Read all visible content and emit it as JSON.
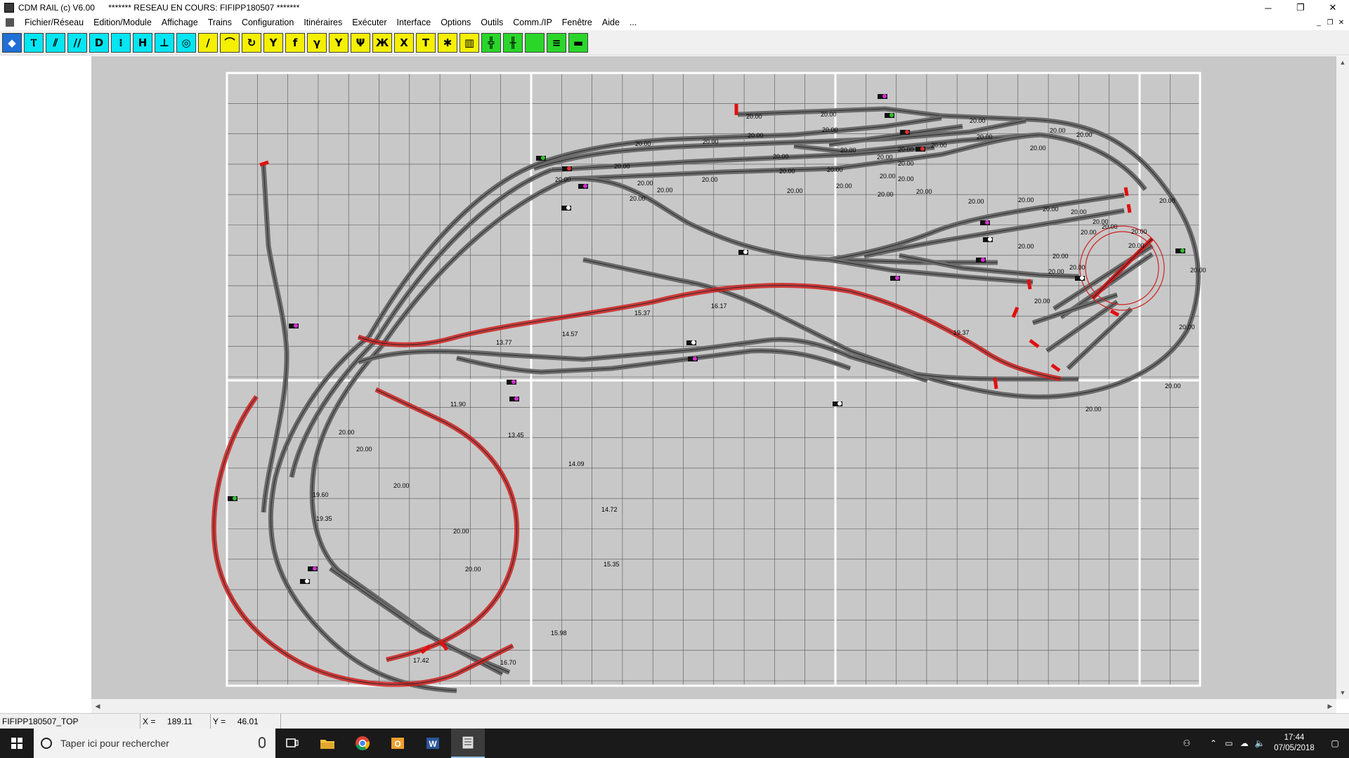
{
  "window": {
    "app_title": "CDM RAIL (c) V6.00",
    "network_title": "******* RESEAU EN COURS: FIFIPP180507 *******",
    "minimize": "─",
    "restore": "❐",
    "close": "✕"
  },
  "menu": {
    "items": [
      "Fichier/Réseau",
      "Edition/Module",
      "Affichage",
      "Trains",
      "Configuration",
      "Itinéraires",
      "Exécuter",
      "Interface",
      "Options",
      "Outils",
      "Comm./IP",
      "Fenêtre",
      "Aide",
      "..."
    ],
    "mdi_minimize": "_",
    "mdi_restore": "❐",
    "mdi_close": "✕"
  },
  "toolbar": {
    "buttons": [
      {
        "name": "zoom-tool",
        "glyph": "◆",
        "color": "blue"
      },
      {
        "name": "signal-tool",
        "glyph": "Ⲧ",
        "color": "cyan"
      },
      {
        "name": "decoupler-tool",
        "glyph": "⫽",
        "color": "cyan"
      },
      {
        "name": "double-track-tool",
        "glyph": "//",
        "color": "cyan"
      },
      {
        "name": "curve-detect-tool",
        "glyph": "D",
        "color": "cyan"
      },
      {
        "name": "detector-tool",
        "glyph": "⁝",
        "color": "cyan"
      },
      {
        "name": "height-tool",
        "glyph": "H",
        "color": "cyan"
      },
      {
        "name": "platform-tool",
        "glyph": "⊥",
        "color": "cyan"
      },
      {
        "name": "turntable-tool",
        "glyph": "◎",
        "color": "cyan"
      },
      {
        "name": "straight-track-tool",
        "glyph": "/",
        "color": "yellow"
      },
      {
        "name": "curved-track-tool",
        "glyph": "⌒",
        "color": "yellow"
      },
      {
        "name": "circle-track-tool",
        "glyph": "↻",
        "color": "yellow"
      },
      {
        "name": "turnout-left-tool",
        "glyph": "Y",
        "color": "yellow"
      },
      {
        "name": "turnout-right-tool",
        "glyph": "f",
        "color": "yellow"
      },
      {
        "name": "curved-turnout-tool",
        "glyph": "γ",
        "color": "yellow"
      },
      {
        "name": "wye-turnout-tool",
        "glyph": "Y",
        "color": "yellow"
      },
      {
        "name": "three-way-turnout-tool",
        "glyph": "Ψ",
        "color": "yellow"
      },
      {
        "name": "double-slip-tool",
        "glyph": "Ж",
        "color": "yellow"
      },
      {
        "name": "crossing-tool",
        "glyph": "X",
        "color": "yellow"
      },
      {
        "name": "buffer-stop-tool",
        "glyph": "T",
        "color": "yellow"
      },
      {
        "name": "scenery-tool",
        "glyph": "✱",
        "color": "yellow"
      },
      {
        "name": "book-tool",
        "glyph": "▥",
        "color": "yellow"
      },
      {
        "name": "module-tool",
        "glyph": "╬",
        "color": "green"
      },
      {
        "name": "module-link-tool",
        "glyph": "╫",
        "color": "green"
      },
      {
        "name": "green-fill-tool",
        "glyph": "",
        "color": "green"
      },
      {
        "name": "layers-tool",
        "glyph": "≡",
        "color": "green"
      },
      {
        "name": "ruler-tool",
        "glyph": "▬",
        "color": "green"
      }
    ]
  },
  "status": {
    "module_name": "FIFIPP180507_TOP",
    "x_label": "X =",
    "x_value": "189.11",
    "y_label": "Y =",
    "y_value": "46.01"
  },
  "taskbar": {
    "search_placeholder": "Taper ici pour rechercher",
    "time": "17:44",
    "date": "07/05/2018"
  },
  "layout": {
    "track_color": "#6b6b6b",
    "rail_color": "#2a2a2a",
    "selected_track_color": "#d02020",
    "buffer_color": "#e01010",
    "grid_color": "#555555",
    "module_border_color": "#ffffff",
    "length_labels": [
      "20.00",
      "20.00",
      "20.00",
      "20.00",
      "20.00",
      "20.00",
      "20.00",
      "20.00",
      "20.00",
      "20.00",
      "20.00",
      "20.00",
      "20.00",
      "20.00",
      "20.00",
      "20.00",
      "20.00",
      "20.00",
      "20.00",
      "20.00",
      "20.00",
      "20.00",
      "20.00",
      "20.00",
      "20.00",
      "20.00",
      "20.00",
      "20.00",
      "20.00",
      "20.00",
      "20.00",
      "20.00",
      "20.00",
      "20.00",
      "20.00",
      "20.00",
      "20.00",
      "20.00",
      "20.00",
      "20.00",
      "20.00",
      "20.00",
      "20.00",
      "20.00",
      "20.00",
      "20.00",
      "20.00",
      "20.00",
      "20.00",
      "20.00",
      "16.17",
      "15.37",
      "14.57",
      "13.77",
      "19.37",
      "11.90",
      "13.45",
      "14.09",
      "14.72",
      "15.35",
      "15.98",
      "16.70",
      "17.42",
      "19.60",
      "19.35",
      "20.00",
      "20.00",
      "20.00",
      "20.00",
      "20.00"
    ]
  }
}
